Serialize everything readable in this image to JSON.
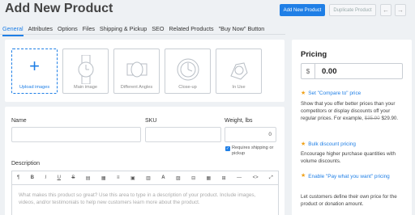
{
  "header": {
    "title": "Add New Product",
    "add_button": "Add New Product",
    "duplicate_button": "Duplicate Product",
    "prev_arrow": "←",
    "next_arrow": "→"
  },
  "tabs": [
    "General",
    "Attributes",
    "Options",
    "Files",
    "Shipping & Pickup",
    "SEO",
    "Related Products",
    "\"Buy Now\" Button"
  ],
  "active_tab": "General",
  "images": {
    "upload_label": "Upload images",
    "slots": [
      "Main image",
      "Different Angles",
      "Close-up",
      "In Use"
    ]
  },
  "form": {
    "name_label": "Name",
    "sku_label": "SKU",
    "weight_label": "Weight, lbs",
    "weight_value": "0",
    "requires_shipping_line1": "Requires shipping or",
    "requires_shipping_line2": "pickup",
    "description_label": "Description",
    "description_placeholder": "What makes this product so great? Use this area to type in a description of your product. Include images, videos, and/or testimonials to help new customers learn more about the product.",
    "toolbar": [
      "¶",
      "B",
      "I",
      "U",
      "S",
      "▤",
      "▦",
      "≡",
      "▣",
      "▥",
      "A",
      "▨",
      "⊟",
      "▦",
      "⊞",
      "—",
      "<>",
      "⤢"
    ]
  },
  "pricing": {
    "title": "Pricing",
    "currency": "$",
    "price": "0.00",
    "tips": [
      {
        "link": "Set \"Compare to\" price",
        "text_before": "Show that you offer better prices than your competitors or display discounts off your regular prices. For example,",
        "struck": "$35.90",
        "text_after": "$29.90."
      },
      {
        "link": "Bulk discount pricing",
        "text": "Encourage higher purchase quantities with volume discounts."
      },
      {
        "link": "Enable \"Pay what you want\" pricing",
        "text": "Let customers define their own price for the product or donation amount."
      }
    ]
  },
  "colors": {
    "accent": "#1f7fe6",
    "star": "#f0a21a"
  }
}
